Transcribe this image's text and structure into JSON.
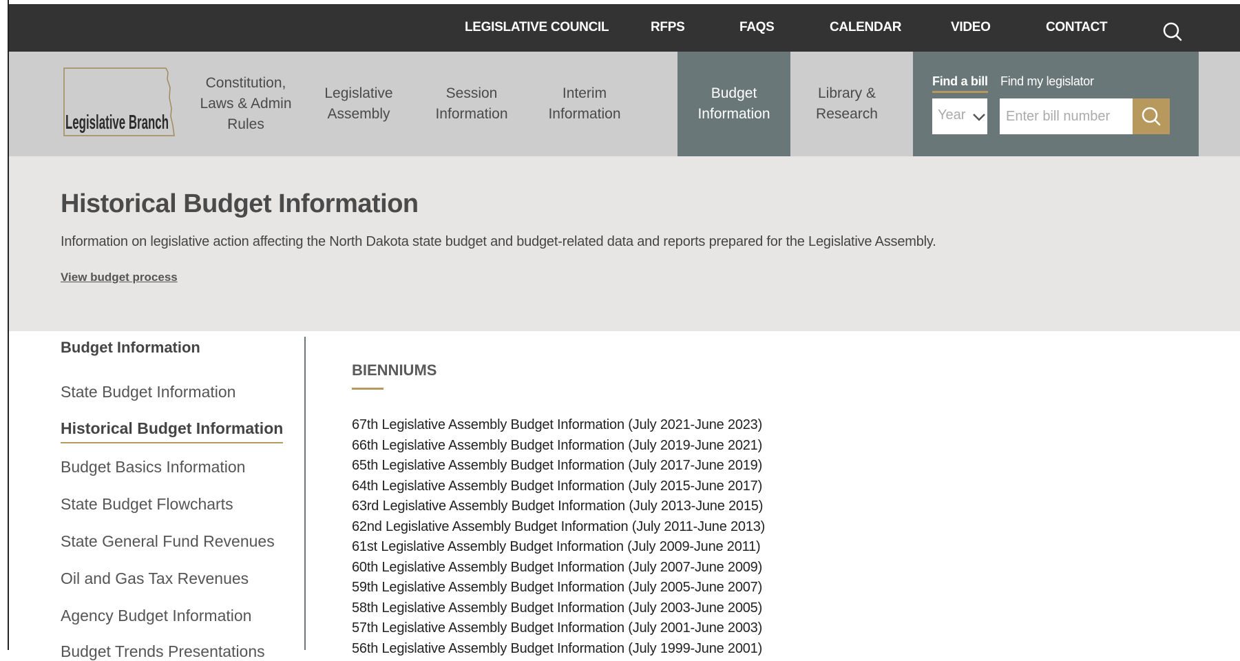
{
  "top_nav": {
    "items": [
      "LEGISLATIVE COUNCIL",
      "RFPS",
      "FAQS",
      "CALENDAR",
      "VIDEO",
      "CONTACT"
    ]
  },
  "logo": {
    "text": "Legislative Branch"
  },
  "main_nav": {
    "items": [
      "Constitution,\nLaws & Admin\nRules",
      "Legislative\nAssembly",
      "Session\nInformation",
      "Interim\nInformation",
      "Budget\nInformation",
      "Library &\nResearch"
    ],
    "active_index": 4
  },
  "find_panel": {
    "tab_bill": "Find a bill",
    "tab_legislator": "Find my legislator",
    "year_placeholder": "Year",
    "bill_placeholder": "Enter bill number"
  },
  "hero": {
    "title": "Historical Budget Information",
    "description": "Information on legislative action affecting the North Dakota state budget and budget-related data and reports prepared for the Legislative Assembly.",
    "process_link": "View budget process"
  },
  "side_nav": {
    "title": "Budget Information",
    "items": [
      "State Budget Information",
      "Historical Budget Information",
      "Budget Basics Information",
      "State Budget Flowcharts",
      "State General Fund Revenues",
      "Oil and Gas Tax Revenues",
      "Agency Budget Information",
      "Budget Trends Presentations"
    ],
    "active_index": 1
  },
  "content": {
    "heading": "BIENNIUMS",
    "bienniums": [
      "67th Legislative Assembly Budget Information (July 2021-June 2023)",
      "66th Legislative Assembly Budget Information (July 2019-June 2021)",
      "65th Legislative Assembly Budget Information (July 2017-June 2019)",
      "64th Legislative Assembly Budget Information (July 2015-June 2017)",
      "63rd Legislative Assembly Budget Information (July 2013-June 2015)",
      "62nd Legislative Assembly Budget Information (July 2011-June 2013)",
      "61st Legislative Assembly Budget Information (July 2009-June 2011)",
      "60th Legislative Assembly Budget Information (July 2007-June 2009)",
      "59th Legislative Assembly Budget Information (July 2005-June 2007)",
      "58th Legislative Assembly Budget Information (July 2003-June 2005)",
      "57th Legislative Assembly Budget Information (July 2001-June 2003)",
      "56th Legislative Assembly Budget Information (July 1999-June 2001)"
    ]
  },
  "colors": {
    "top_bar": "#333333",
    "nav_bg": "#cdcdcd",
    "active_bg": "#6a7778",
    "accent_gold": "#b7995e",
    "hero_bg": "#e8e6e4"
  },
  "icons": {
    "top_search": "search-icon",
    "bill_search": "search-icon",
    "year_chevron": "chevron-down-icon"
  }
}
